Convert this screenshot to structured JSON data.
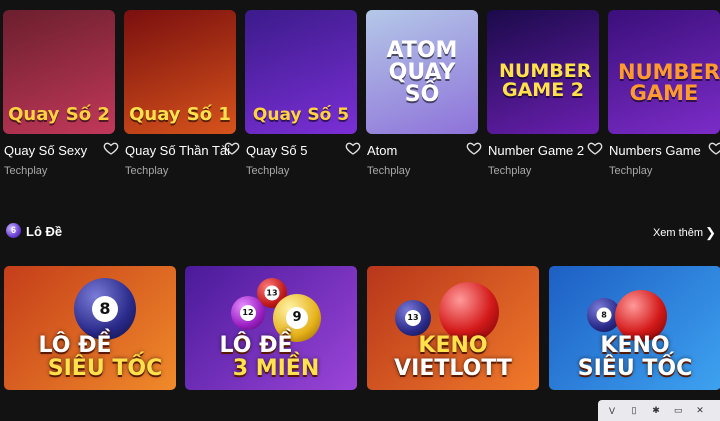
{
  "games": [
    {
      "title": "Quay Số Sexy",
      "provider": "Techplay",
      "thumb_text": "Quay Số 2",
      "bg": [
        "#6b1f2e",
        "#c2385a"
      ],
      "fg": "#ffd23f"
    },
    {
      "title": "Quay Số Thần Tài",
      "provider": "Techplay",
      "thumb_text": "Quay Số 1",
      "bg": [
        "#7a0f0f",
        "#d6531b"
      ],
      "fg": "#ffe14d"
    },
    {
      "title": "Quay Số 5",
      "provider": "Techplay",
      "thumb_text": "Quay Số 5",
      "bg": [
        "#3b1b8a",
        "#7b2fd6"
      ],
      "fg": "#ffd23f"
    },
    {
      "title": "Atom",
      "provider": "Techplay",
      "thumb_text": "ATOM QUAY SỐ",
      "bg": [
        "#b4c8e8",
        "#8e72d9"
      ],
      "fg": "#ffffff"
    },
    {
      "title": "Number Game 2",
      "provider": "Techplay",
      "thumb_text": "NUMBER GAME 2",
      "bg": [
        "#1b0a4a",
        "#6a1fb0"
      ],
      "fg": "#ffe24a"
    },
    {
      "title": "Numbers Game",
      "provider": "Techplay",
      "thumb_text": "NUMBER GAME",
      "bg": [
        "#3a0f7a",
        "#7c2cc8"
      ],
      "fg": "#ff9b2e"
    }
  ],
  "section": {
    "icon_text": "6",
    "title": "Lô Đề",
    "see_more": "Xem thêm",
    "see_more_chevron": "❯"
  },
  "lotto": [
    {
      "line1": "LÔ ĐỀ",
      "line2": "SIÊU TỐC",
      "bg": [
        "#c53e1a",
        "#f08a2a"
      ],
      "balls": [
        "8"
      ]
    },
    {
      "line1": "LÔ ĐỀ",
      "line2": "3 MIỀN",
      "bg": [
        "#4a1a9a",
        "#9b45d8"
      ],
      "balls": [
        "13",
        "12",
        "9"
      ]
    },
    {
      "line1": "KENO",
      "line2": "VIETLOTT",
      "bg": [
        "#b8361b",
        "#f07a2a"
      ],
      "balls": [
        "13"
      ]
    },
    {
      "line1": "KENO",
      "line2": "SIÊU TỐC",
      "bg": [
        "#1d5fc4",
        "#3ea2f0"
      ],
      "balls": [
        "8"
      ]
    }
  ],
  "toolbar": {
    "items": [
      "V",
      "▯",
      "✱",
      "▭",
      "✕"
    ]
  }
}
